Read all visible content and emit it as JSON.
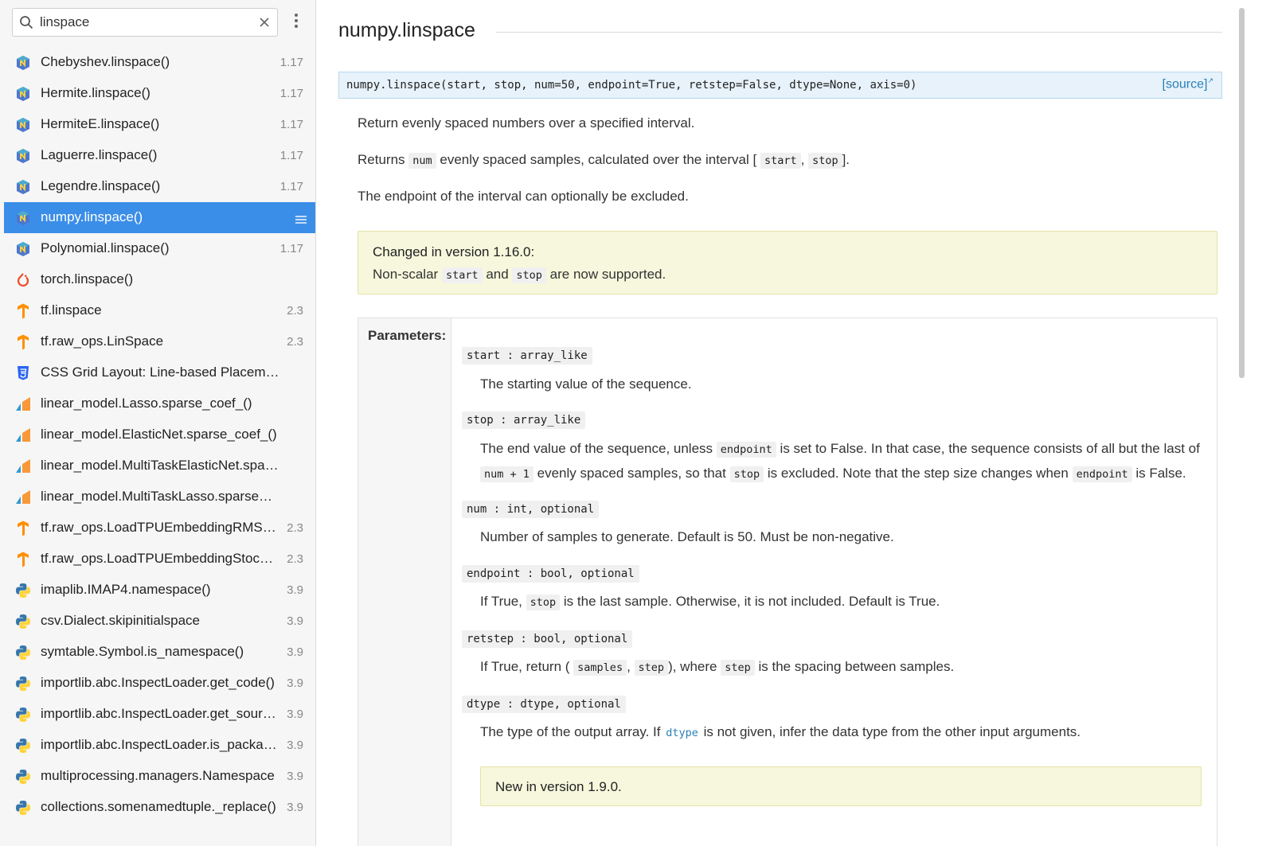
{
  "search": {
    "value": "linspace",
    "placeholder": ""
  },
  "results": [
    {
      "label": "Chebyshev.linspace()",
      "version": "1.17",
      "icon": "numpy-icon"
    },
    {
      "label": "Hermite.linspace()",
      "version": "1.17",
      "icon": "numpy-icon"
    },
    {
      "label": "HermiteE.linspace()",
      "version": "1.17",
      "icon": "numpy-icon"
    },
    {
      "label": "Laguerre.linspace()",
      "version": "1.17",
      "icon": "numpy-icon"
    },
    {
      "label": "Legendre.linspace()",
      "version": "1.17",
      "icon": "numpy-icon"
    },
    {
      "label": "numpy.linspace()",
      "version": "",
      "icon": "numpy-icon",
      "selected": true
    },
    {
      "label": "Polynomial.linspace()",
      "version": "1.17",
      "icon": "numpy-icon"
    },
    {
      "label": "torch.linspace()",
      "version": "",
      "icon": "pytorch-icon"
    },
    {
      "label": "tf.linspace",
      "version": "2.3",
      "icon": "tensorflow-icon"
    },
    {
      "label": "tf.raw_ops.LinSpace",
      "version": "2.3",
      "icon": "tensorflow-icon"
    },
    {
      "label": "CSS Grid Layout: Line-based Placement wi...",
      "version": "",
      "icon": "css-icon"
    },
    {
      "label": "linear_model.Lasso.sparse_coef_()",
      "version": "",
      "icon": "sklearn-icon"
    },
    {
      "label": "linear_model.ElasticNet.sparse_coef_()",
      "version": "",
      "icon": "sklearn-icon"
    },
    {
      "label": "linear_model.MultiTaskElasticNet.sparse_c...",
      "version": "",
      "icon": "sklearn-icon"
    },
    {
      "label": "linear_model.MultiTaskLasso.sparse_coef_()",
      "version": "",
      "icon": "sklearn-icon"
    },
    {
      "label": "tf.raw_ops.LoadTPUEmbeddingRMSPr...",
      "version": "2.3",
      "icon": "tensorflow-icon"
    },
    {
      "label": "tf.raw_ops.LoadTPUEmbeddingStocha...",
      "version": "2.3",
      "icon": "tensorflow-icon"
    },
    {
      "label": "imaplib.IMAP4.namespace()",
      "version": "3.9",
      "icon": "python-icon"
    },
    {
      "label": "csv.Dialect.skipinitialspace",
      "version": "3.9",
      "icon": "python-icon"
    },
    {
      "label": "symtable.Symbol.is_namespace()",
      "version": "3.9",
      "icon": "python-icon"
    },
    {
      "label": "importlib.abc.InspectLoader.get_code()",
      "version": "3.9",
      "icon": "python-icon"
    },
    {
      "label": "importlib.abc.InspectLoader.get_sourc...",
      "version": "3.9",
      "icon": "python-icon"
    },
    {
      "label": "importlib.abc.InspectLoader.is_packag...",
      "version": "3.9",
      "icon": "python-icon"
    },
    {
      "label": "multiprocessing.managers.Namespace",
      "version": "3.9",
      "icon": "python-icon"
    },
    {
      "label": "collections.somenamedtuple._replace()",
      "version": "3.9",
      "icon": "python-icon"
    }
  ],
  "doc": {
    "title": "numpy.linspace",
    "signature": "numpy.linspace(start, stop, num=50, endpoint=True, retstep=False, dtype=None, axis=0)",
    "source_label": "[source]",
    "p1": "Return evenly spaced numbers over a specified interval.",
    "p2": {
      "a": "Returns",
      "code1": "num",
      "b": "evenly spaced samples, calculated over the interval [",
      "code2": "start",
      "c": ",",
      "code3": "stop",
      "d": "]."
    },
    "p3": "The endpoint of the interval can optionally be excluded.",
    "changed": {
      "title": "Changed in version 1.16.0:",
      "a": "Non-scalar",
      "code1": "start",
      "b": "and",
      "code2": "stop",
      "c": "are now supported."
    },
    "params_label": "Parameters:",
    "params": {
      "start": {
        "name": "start : array_like",
        "desc": "The starting value of the sequence."
      },
      "stop": {
        "name": "stop : array_like",
        "l1a": "The end value of the sequence, unless",
        "l1code": "endpoint",
        "l1b": "is set to False. In that case, the sequence consists of all but the last of",
        "l2code1": "num + 1",
        "l2a": "evenly spaced samples, so that",
        "l2code2": "stop",
        "l2b": "is excluded. Note that the step size changes when",
        "l2code3": "endpoint",
        "l2c": "is False."
      },
      "num": {
        "name": "num : int, optional",
        "desc": "Number of samples to generate. Default is 50. Must be non-negative."
      },
      "endpoint": {
        "name": "endpoint : bool, optional",
        "a": "If True,",
        "code": "stop",
        "b": "is the last sample. Otherwise, it is not included. Default is True."
      },
      "retstep": {
        "name": "retstep : bool, optional",
        "a": "If True, return (",
        "code1": "samples",
        "b": ",",
        "code2": "step",
        "c": "), where",
        "code3": "step",
        "d": "is the spacing between samples."
      },
      "dtype": {
        "name": "dtype : dtype, optional",
        "a": "The type of the output array. If",
        "code": "dtype",
        "b": "is not given, infer the data type from the other input arguments."
      }
    },
    "new_in": "New in version 1.9.0."
  },
  "colors": {
    "selected_bg": "#3b8ee8",
    "signature_bg": "#e7f2fa",
    "admonition_bg": "#f6f7dc",
    "link": "#2980b9"
  }
}
